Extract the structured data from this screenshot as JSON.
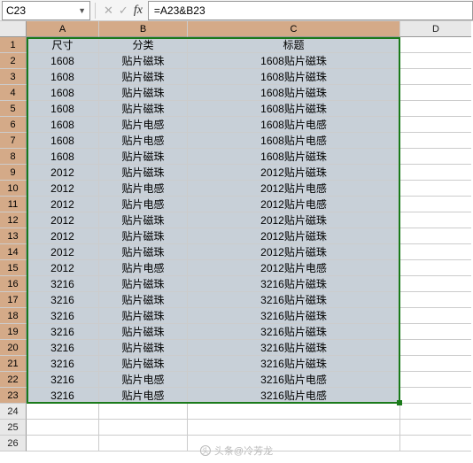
{
  "name_box": "C23",
  "formula": "=A23&B23",
  "col_labels": {
    "a": "A",
    "b": "B",
    "c": "C",
    "d": "D"
  },
  "row_labels": [
    "1",
    "2",
    "3",
    "4",
    "5",
    "6",
    "7",
    "8",
    "9",
    "10",
    "11",
    "12",
    "13",
    "14",
    "15",
    "16",
    "17",
    "18",
    "19",
    "20",
    "21",
    "22",
    "23",
    "24",
    "25",
    "26"
  ],
  "headers": {
    "a": "尺寸",
    "b": "分类",
    "c": "标题"
  },
  "rows": [
    {
      "a": "1608",
      "b": "贴片磁珠",
      "c": "1608贴片磁珠"
    },
    {
      "a": "1608",
      "b": "贴片磁珠",
      "c": "1608贴片磁珠"
    },
    {
      "a": "1608",
      "b": "贴片磁珠",
      "c": "1608贴片磁珠"
    },
    {
      "a": "1608",
      "b": "贴片磁珠",
      "c": "1608贴片磁珠"
    },
    {
      "a": "1608",
      "b": "贴片电感",
      "c": "1608贴片电感"
    },
    {
      "a": "1608",
      "b": "贴片电感",
      "c": "1608贴片电感"
    },
    {
      "a": "1608",
      "b": "贴片磁珠",
      "c": "1608贴片磁珠"
    },
    {
      "a": "2012",
      "b": "贴片磁珠",
      "c": "2012贴片磁珠"
    },
    {
      "a": "2012",
      "b": "贴片电感",
      "c": "2012贴片电感"
    },
    {
      "a": "2012",
      "b": "贴片电感",
      "c": "2012贴片电感"
    },
    {
      "a": "2012",
      "b": "贴片磁珠",
      "c": "2012贴片磁珠"
    },
    {
      "a": "2012",
      "b": "贴片磁珠",
      "c": "2012贴片磁珠"
    },
    {
      "a": "2012",
      "b": "贴片磁珠",
      "c": "2012贴片磁珠"
    },
    {
      "a": "2012",
      "b": "贴片电感",
      "c": "2012贴片电感"
    },
    {
      "a": "3216",
      "b": "贴片磁珠",
      "c": "3216贴片磁珠"
    },
    {
      "a": "3216",
      "b": "贴片磁珠",
      "c": "3216贴片磁珠"
    },
    {
      "a": "3216",
      "b": "贴片磁珠",
      "c": "3216贴片磁珠"
    },
    {
      "a": "3216",
      "b": "贴片磁珠",
      "c": "3216贴片磁珠"
    },
    {
      "a": "3216",
      "b": "贴片磁珠",
      "c": "3216贴片磁珠"
    },
    {
      "a": "3216",
      "b": "贴片磁珠",
      "c": "3216贴片磁珠"
    },
    {
      "a": "3216",
      "b": "贴片电感",
      "c": "3216贴片电感"
    },
    {
      "a": "3216",
      "b": "贴片电感",
      "c": "3216贴片电感"
    }
  ],
  "watermark": "头条@冷芳龙"
}
